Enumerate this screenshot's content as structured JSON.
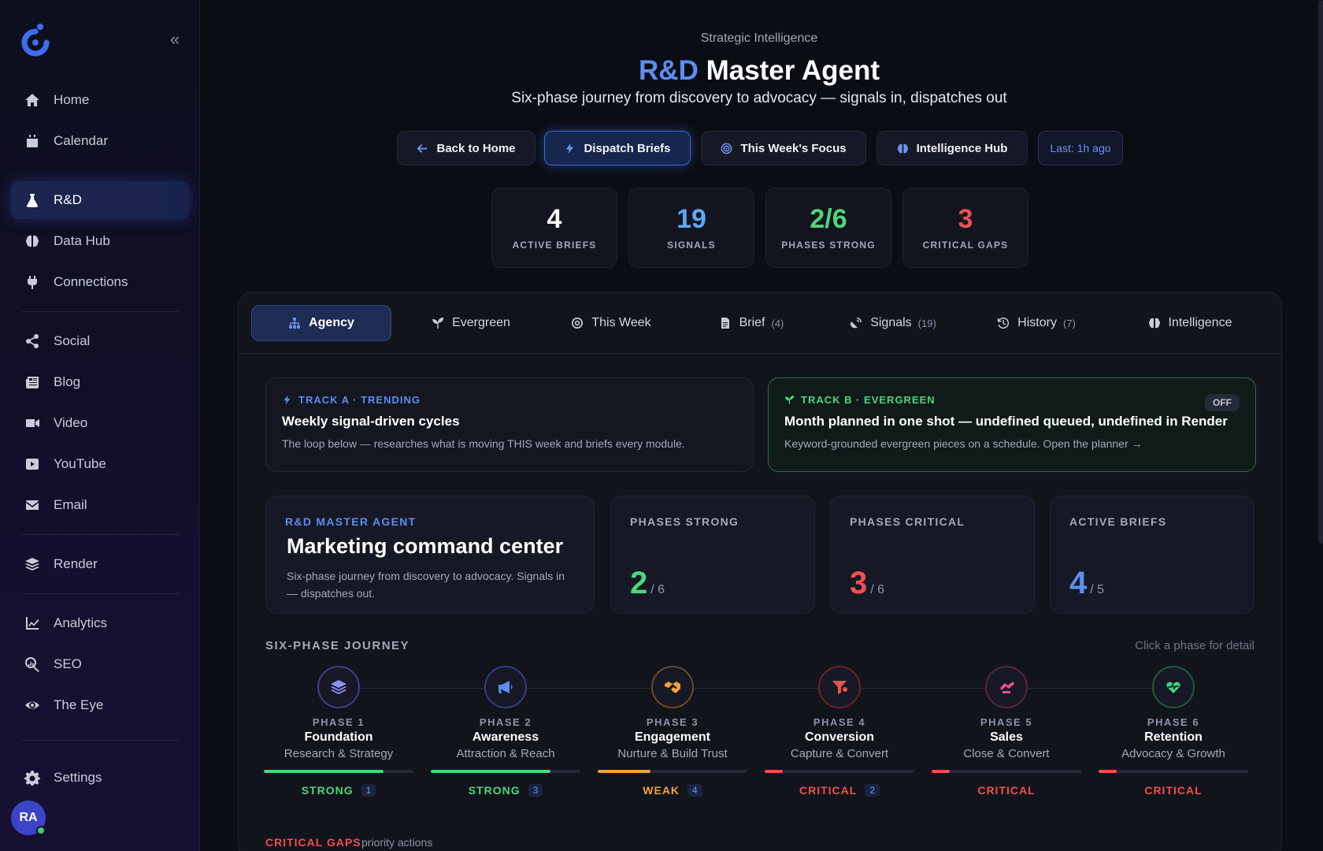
{
  "sidebar": {
    "items": [
      {
        "label": "Home",
        "icon": "home-icon"
      },
      {
        "label": "Calendar",
        "icon": "calendar-icon"
      },
      {
        "label": "R&D",
        "icon": "flask-icon"
      },
      {
        "label": "Data Hub",
        "icon": "brain-icon"
      },
      {
        "label": "Connections",
        "icon": "plug-icon"
      },
      {
        "label": "Social",
        "icon": "share-icon"
      },
      {
        "label": "Blog",
        "icon": "newspaper-icon"
      },
      {
        "label": "Video",
        "icon": "video-icon"
      },
      {
        "label": "YouTube",
        "icon": "youtube-icon"
      },
      {
        "label": "Email",
        "icon": "envelope-icon"
      },
      {
        "label": "Render",
        "icon": "layers-icon"
      },
      {
        "label": "Analytics",
        "icon": "chart-line-icon"
      },
      {
        "label": "SEO",
        "icon": "magnifier-chart-icon"
      },
      {
        "label": "The Eye",
        "icon": "eye-icon"
      },
      {
        "label": "Settings",
        "icon": "gear-icon"
      }
    ],
    "active": "R&D",
    "avatar_initials": "RA"
  },
  "header": {
    "kicker": "Strategic Intelligence",
    "title_accent": "R&D",
    "title_rest": " Master Agent",
    "subtitle": "Six-phase journey from discovery to advocacy — signals in, dispatches out"
  },
  "actions": {
    "back": "Back to Home",
    "dispatch": "Dispatch Briefs",
    "focus": "This Week's Focus",
    "hub": "Intelligence Hub",
    "last": "Last: 1h ago"
  },
  "stats": [
    {
      "value": "4",
      "label": "ACTIVE BRIEFS",
      "color": "#ffffff"
    },
    {
      "value": "19",
      "label": "SIGNALS",
      "color": "#5fa8f5"
    },
    {
      "value": "2/6",
      "label": "PHASES STRONG",
      "color": "#4ed67a"
    },
    {
      "value": "3",
      "label": "CRITICAL GAPS",
      "color": "#ef4f4f"
    }
  ],
  "tabs": [
    {
      "label": "Agency",
      "count": ""
    },
    {
      "label": "Evergreen",
      "count": ""
    },
    {
      "label": "This Week",
      "count": ""
    },
    {
      "label": "Brief",
      "count": "(4)"
    },
    {
      "label": "Signals",
      "count": "(19)"
    },
    {
      "label": "History",
      "count": "(7)"
    },
    {
      "label": "Intelligence",
      "count": ""
    }
  ],
  "track_a": {
    "kicker": "TRACK A · TRENDING",
    "title": "Weekly signal-driven cycles",
    "desc": "The loop below — researches what is moving THIS week and briefs every module."
  },
  "track_b": {
    "kicker": "TRACK B · EVERGREEN",
    "badge": "OFF",
    "title": "Month planned in one shot — undefined queued, undefined in Render",
    "desc": "Keyword-grounded evergreen pieces on a schedule. Open the planner →"
  },
  "hero": {
    "kicker": "R&D MASTER AGENT",
    "title": "Marketing command center",
    "desc": "Six-phase journey from discovery to advocacy. Signals in — dispatches out."
  },
  "metrics": [
    {
      "label": "PHASES STRONG",
      "value": "2",
      "of": "/ 6",
      "color": "#4ed67a"
    },
    {
      "label": "PHASES CRITICAL",
      "value": "3",
      "of": "/ 6",
      "color": "#ef4f4f"
    },
    {
      "label": "ACTIVE BRIEFS",
      "value": "4",
      "of": "/ 5",
      "color": "#5b8def"
    }
  ],
  "journey": {
    "label": "SIX-PHASE JOURNEY",
    "hint": "Click a phase for detail",
    "phases": [
      {
        "num": "PHASE 1",
        "name": "Foundation",
        "sub": "Research & Strategy",
        "status": "STRONG",
        "count": "1",
        "fill": 0.8,
        "color": "#4ed67a",
        "icon": "layers-icon",
        "ring": "#3c3f8c",
        "icolor": "#8a8ff5"
      },
      {
        "num": "PHASE 2",
        "name": "Awareness",
        "sub": "Attraction & Reach",
        "status": "STRONG",
        "count": "3",
        "fill": 0.8,
        "color": "#4ed67a",
        "icon": "megaphone-icon",
        "ring": "#2c3f80",
        "icolor": "#5b8def"
      },
      {
        "num": "PHASE 3",
        "name": "Engagement",
        "sub": "Nurture & Build Trust",
        "status": "WEAK",
        "count": "4",
        "fill": 0.35,
        "color": "#f0a23a",
        "icon": "handshake-icon",
        "ring": "#6a4a1e",
        "icolor": "#f0a23a"
      },
      {
        "num": "PHASE 4",
        "name": "Conversion",
        "sub": "Capture & Convert",
        "status": "CRITICAL",
        "count": "2",
        "fill": 0.12,
        "color": "#ef4f4f",
        "icon": "funnel-icon",
        "ring": "#6a2323",
        "icolor": "#ef4f4f"
      },
      {
        "num": "PHASE 5",
        "name": "Sales",
        "sub": "Close & Convert",
        "status": "CRITICAL",
        "count": "",
        "fill": 0.12,
        "color": "#ef4f4f",
        "icon": "deal-icon",
        "ring": "#5e2240",
        "icolor": "#e8548c"
      },
      {
        "num": "PHASE 6",
        "name": "Retention",
        "sub": "Advocacy & Growth",
        "status": "CRITICAL",
        "count": "",
        "fill": 0.12,
        "color": "#ef4f4f",
        "icon": "heart-pulse-icon",
        "ring": "#1f5a3c",
        "icolor": "#3fcf8e"
      }
    ]
  },
  "critical": {
    "label": "CRITICAL GAPS",
    "sub": "priority actions"
  }
}
